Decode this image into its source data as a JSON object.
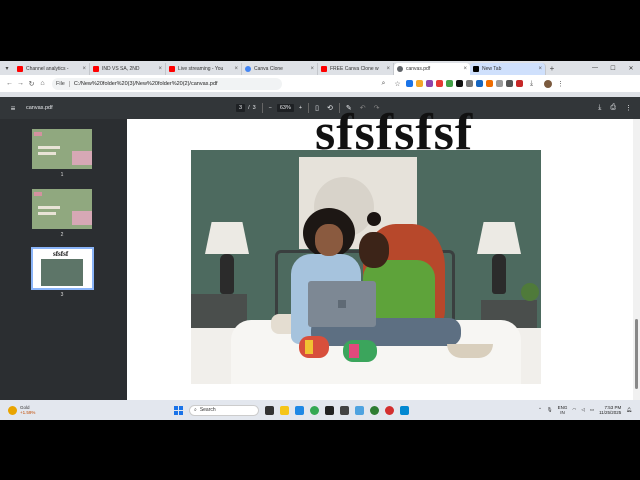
{
  "browser": {
    "tabs": [
      {
        "title": "Channel analytics -",
        "favicon_color": "#ff0000",
        "active": false
      },
      {
        "title": "IND VS SA, 2ND",
        "favicon_color": "#ff0000",
        "active": false
      },
      {
        "title": "Live streaming - You",
        "favicon_color": "#ff0000",
        "active": false
      },
      {
        "title": "Canva Clone",
        "favicon_color": "#4285f4",
        "active": false
      },
      {
        "title": "FREE Canva Clone w",
        "favicon_color": "#ff0000",
        "active": false
      },
      {
        "title": "canvas.pdf",
        "favicon_color": "#5f6368",
        "active": true
      },
      {
        "title": "New Tab",
        "favicon_color": "#000000",
        "active": false
      }
    ],
    "address": {
      "scheme_label": "File",
      "url": "C:/New%20folder%20(3)/New%20folder%20(2)/canvas.pdf"
    }
  },
  "pdf_toolbar": {
    "file_name": "canvas.pdf",
    "current_page": "3",
    "page_separator": "/",
    "total_pages": "3",
    "zoom": "63%",
    "zoom_minus": "−",
    "zoom_plus": "+"
  },
  "sidebar": {
    "thumbnails": [
      {
        "label": "1"
      },
      {
        "label": "2"
      },
      {
        "label": "3",
        "title_text": "sfsfsf"
      }
    ]
  },
  "page": {
    "heading": "sfsfsfsf"
  },
  "taskbar": {
    "weather_label": "Gold",
    "weather_change": "+1.59%",
    "search_placeholder": "Search",
    "lang_line1": "ENG",
    "lang_line2": "IN",
    "time": "7:53 PM",
    "date": "11/25/2025"
  }
}
